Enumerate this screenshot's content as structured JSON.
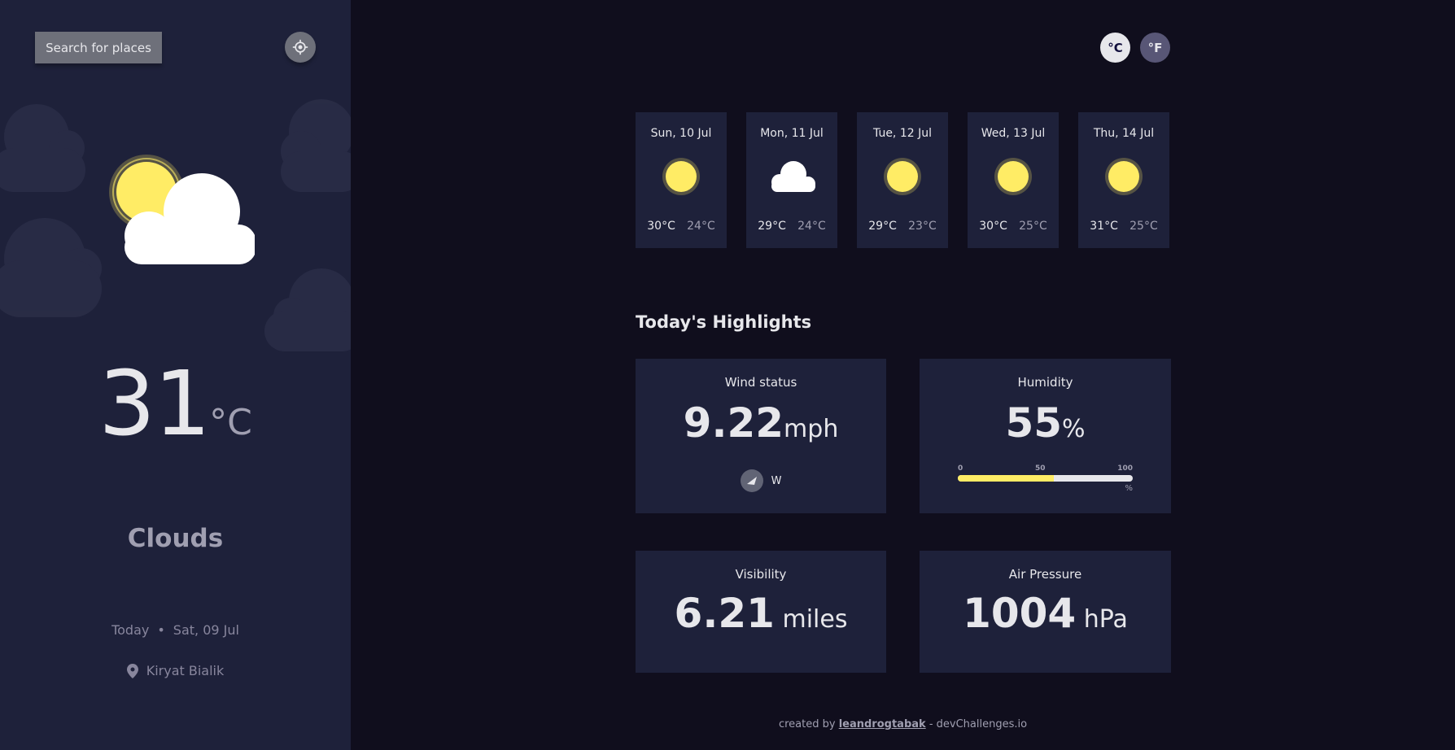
{
  "sidebar": {
    "search_label": "Search for places",
    "location_icon": "crosshair-icon",
    "current_icon": "sun-cloud-icon",
    "temperature": "31",
    "temperature_unit": "°C",
    "condition": "Clouds",
    "date_prefix": "Today",
    "separator": "•",
    "date": "Sat, 09 Jul",
    "location_pin_icon": "map-pin-icon",
    "location": "Kiryat Bialik"
  },
  "units": {
    "celsius": "°C",
    "fahrenheit": "°F"
  },
  "forecast": [
    {
      "day": "Sun, 10 Jul",
      "icon": "sun-icon",
      "max": "30°C",
      "min": "24°C"
    },
    {
      "day": "Mon, 11 Jul",
      "icon": "cloud-icon",
      "max": "29°C",
      "min": "24°C"
    },
    {
      "day": "Tue, 12 Jul",
      "icon": "sun-icon",
      "max": "29°C",
      "min": "23°C"
    },
    {
      "day": "Wed, 13 Jul",
      "icon": "sun-icon",
      "max": "30°C",
      "min": "25°C"
    },
    {
      "day": "Thu, 14 Jul",
      "icon": "sun-icon",
      "max": "31°C",
      "min": "25°C"
    }
  ],
  "highlights": {
    "title": "Today's Highlights",
    "wind": {
      "label": "Wind status",
      "value": "9.22",
      "unit": "mph",
      "direction": "W"
    },
    "humidity": {
      "label": "Humidity",
      "value": "55",
      "unit": "%",
      "percent": 55,
      "tick_0": "0",
      "tick_50": "50",
      "tick_100": "100",
      "bar_unit": "%"
    },
    "visibility": {
      "label": "Visibility",
      "value": "6.21",
      "unit": "miles"
    },
    "pressure": {
      "label": "Air Pressure",
      "value": "1004",
      "unit": "hPa"
    }
  },
  "colors": {
    "sidebar_bg": "#1e213a",
    "page_bg": "#100e1d",
    "accent_yellow": "#ffec65"
  },
  "footer": {
    "prefix": "created by",
    "author": "leandrogtabak",
    "suffix": "- devChallenges.io"
  }
}
